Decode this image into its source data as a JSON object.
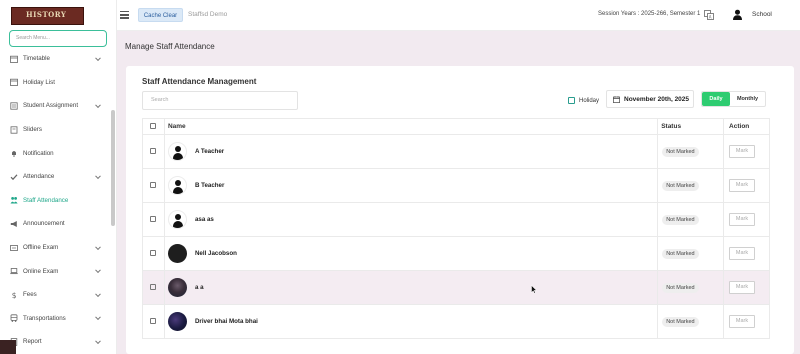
{
  "logo_text": "HISTORY",
  "sidebar": {
    "search_placeholder": "Search Menu...",
    "items": [
      {
        "label": "Timetable",
        "icon": "calendar-icon",
        "chevron": true
      },
      {
        "label": "Holiday List",
        "icon": "calendar-icon",
        "chevron": false
      },
      {
        "label": "Student Assignment",
        "icon": "assignment-icon",
        "chevron": true
      },
      {
        "label": "Sliders",
        "icon": "sliders-icon",
        "chevron": false
      },
      {
        "label": "Notification",
        "icon": "bell-icon",
        "chevron": false
      },
      {
        "label": "Attendance",
        "icon": "check-icon",
        "chevron": true
      },
      {
        "label": "Staff Attendance",
        "icon": "staff-icon",
        "chevron": false,
        "active": true
      },
      {
        "label": "Announcement",
        "icon": "megaphone-icon",
        "chevron": false
      },
      {
        "label": "Offline Exam",
        "icon": "exam-icon",
        "chevron": true
      },
      {
        "label": "Online Exam",
        "icon": "laptop-icon",
        "chevron": true
      },
      {
        "label": "Fees",
        "icon": "dollar-icon",
        "chevron": true
      },
      {
        "label": "Transportations",
        "icon": "bus-icon",
        "chevron": true
      },
      {
        "label": "Report",
        "icon": "report-icon",
        "chevron": true
      }
    ]
  },
  "topbar": {
    "cache_button": "Cache Clear",
    "app_name": "Staffsd Demo",
    "session": "Session Years : 2025-266, Semester 1",
    "school": "School"
  },
  "main": {
    "page_title": "Manage Staff Attendance",
    "card_title": "Staff Attendance Management",
    "search_placeholder": "Search",
    "holiday_label": "Holiday",
    "date": "November 20th, 2025",
    "toggle_daily": "Daily",
    "toggle_monthly": "Monthly",
    "columns": {
      "name": "Name",
      "status": "Status",
      "action": "Action"
    },
    "rows": [
      {
        "name": "A Teacher",
        "status": "Not Marked",
        "action": "Mark",
        "avatar": "default"
      },
      {
        "name": "B Teacher",
        "status": "Not Marked",
        "action": "Mark",
        "avatar": "default"
      },
      {
        "name": "asa as",
        "status": "Not Marked",
        "action": "Mark",
        "avatar": "default"
      },
      {
        "name": "Nell Jacobson",
        "status": "Not Marked",
        "action": "Mark",
        "avatar": "dark"
      },
      {
        "name": "a a",
        "status": "Not Marked",
        "action": "Mark",
        "avatar": "photo1"
      },
      {
        "name": "Driver bhai Mota bhai",
        "status": "Not Marked",
        "action": "Mark",
        "avatar": "photo2"
      }
    ]
  }
}
